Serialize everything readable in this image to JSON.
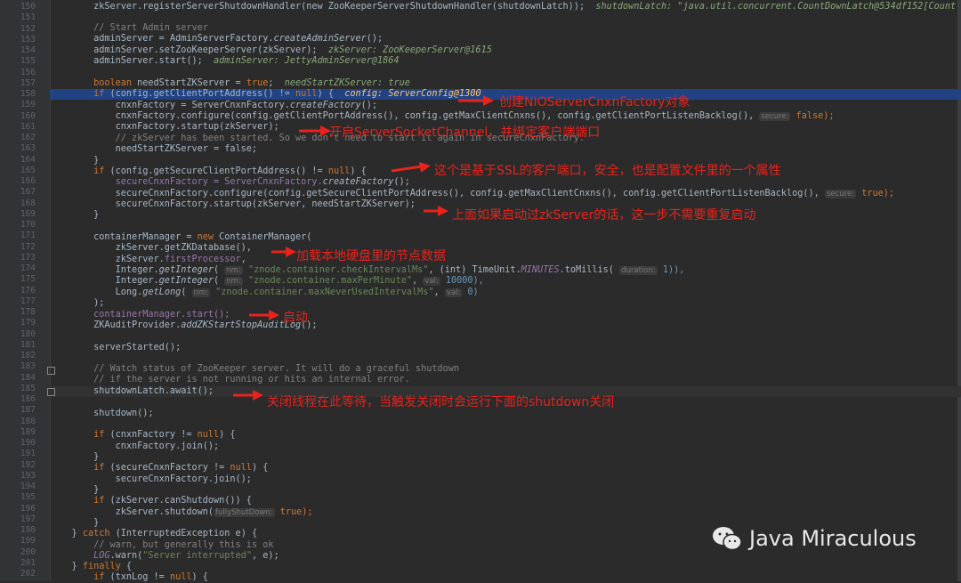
{
  "gutter": {
    "line_numbers": [
      "150",
      "151",
      "152",
      "153",
      "154",
      "155",
      "156",
      "157",
      "158",
      "159",
      "160",
      "161",
      "162",
      "163",
      "164",
      "165",
      "166",
      "167",
      "168",
      "169",
      "170",
      "171",
      "172",
      "173",
      "174",
      "175",
      "176",
      "177",
      "178",
      "179",
      "180",
      "181",
      "182",
      "183",
      "184",
      "185",
      "186",
      "187",
      "188",
      "189",
      "190",
      "191",
      "192",
      "193",
      "194",
      "195",
      "196",
      "197",
      "198",
      "199",
      "200",
      "201",
      "202"
    ]
  },
  "code": {
    "l150": "        zkServer.registerServerShutdownHandler(new ZooKeeperServerShutdownHandler(shutdownLatch));",
    "l150_dbg": "shutdownLatch: \"java.util.concurrent.CountDownLatch@534df152[Count = 1]\"",
    "l152": "        // Start Admin server",
    "l153a": "        adminServer = AdminServerFactory.",
    "l153b": "createAdminServer",
    "l153c": "();",
    "l154": "        adminServer.setZooKeeperServer(zkServer);",
    "l154_dbg": "zkServer: ZooKeeperServer@1615",
    "l155": "        adminServer.start();",
    "l155_dbg": "adminServer: JettyAdminServer@1864",
    "l157a": "        boolean ",
    "l157b": "needStartZKServer = ",
    "l157c": "true",
    "l157d": ";",
    "l157_dbg": "needStartZKServer: true",
    "l158a": "        if ",
    "l158b": "(config.getClientPortAddress() != ",
    "l158c": "null",
    "l158d": ") {",
    "l158_dbg": "config: ServerConfig@1300",
    "l159a": "            cnxnFactory = ServerCnxnFactory.",
    "l159b": "createFactory",
    "l159c": "();",
    "l160": "            cnxnFactory.configure(config.getClientPortAddress(), config.getMaxClientCnxns(), config.getClientPortListenBacklog(),",
    "l160_hint": "secure:",
    "l160_end": " false);",
    "l161": "            cnxnFactory.startup(zkServer);",
    "l162": "            // zkServer has been started. So we don't need to start it again in secureCnxnFactory.",
    "l163": "            needStartZKServer = false;",
    "l164": "        }",
    "l165a": "        if ",
    "l165b": "(config.getSecureClientPortAddress() != ",
    "l165c": "null",
    "l165d": ") {",
    "l166a": "            secureCnxnFactory = ServerCnxnFactory.",
    "l166b": "createFactory",
    "l166c": "();",
    "l167": "            secureCnxnFactory.configure(config.getSecureClientPortAddress(), config.getMaxClientCnxns(), config.getClientPortListenBacklog(),",
    "l167_hint": "secure:",
    "l167_end": " true);",
    "l168": "            secureCnxnFactory.startup(zkServer, needStartZKServer);",
    "l169": "        }",
    "l171a": "        containerManager = ",
    "l171b": "new ",
    "l171c": "ContainerManager(",
    "l172": "            zkServer.getZKDatabase(),",
    "l173a": "            zkServer.",
    "l173b": "firstProcessor",
    "l173c": ",",
    "l174a": "            Integer.",
    "l174b": "getInteger",
    "l174c": "(",
    "l174_hint": "nm:",
    "l174d": " \"znode.container.checkIntervalMs\"",
    "l174e": ", (int) TimeUnit.",
    "l174f": "MINUTES",
    "l174g": ".toMillis(",
    "l174_hint2": "duration:",
    "l174h": " 1)),",
    "l175a": "            Integer.",
    "l175b": "getInteger",
    "l175c": "(",
    "l175_hint": "nm:",
    "l175d": " \"znode.container.maxPerMinute\"",
    "l175e": ", ",
    "l175_hint2": "val:",
    "l175f": " 10000),",
    "l176a": "            Long.",
    "l176b": "getLong",
    "l176c": "(",
    "l176_hint": "nm:",
    "l176d": " \"znode.container.maxNeverUsedIntervalMs\"",
    "l176e": ", ",
    "l176_hint2": "val:",
    "l176f": " 0)",
    "l177": "        );",
    "l178": "        containerManager.start();",
    "l179a": "        ZKAuditProvider.",
    "l179b": "addZKStartStopAuditLog",
    "l179c": "();",
    "l181": "        serverStarted();",
    "l183": "        // Watch status of ZooKeeper server. It will do a graceful shutdown",
    "l184": "        // if the server is not running or hits an internal error.",
    "l185": "        shutdownLatch.await();",
    "l187": "        shutdown();",
    "l189a": "        if ",
    "l189b": "(cnxnFactory != ",
    "l189c": "null",
    "l189d": ") {",
    "l190": "            cnxnFactory.join();",
    "l191": "        }",
    "l192a": "        if ",
    "l192b": "(secureCnxnFactory != ",
    "l192c": "null",
    "l192d": ") {",
    "l193": "            secureCnxnFactory.join();",
    "l194": "        }",
    "l195a": "        if ",
    "l195b": "(zkServer.canShutdown()) {",
    "l196a": "            zkServer.shutdown(",
    "l196_hint": "fullyShutDown:",
    "l196b": " true);",
    "l197": "        }",
    "l198a": "    } ",
    "l198b": "catch ",
    "l198c": "(InterruptedException e) {",
    "l199": "        // warn, but generally this is ok",
    "l200a": "        ",
    "l200b": "LOG",
    "l200c": ".warn(",
    "l200d": "\"Server interrupted\"",
    "l200e": ", e);",
    "l201a": "    } ",
    "l201b": "finally ",
    "l201c": "{",
    "l202a": "        if ",
    "l202b": "(txnLog != ",
    "l202c": "null",
    "l202d": ") {"
  },
  "annotations": {
    "a1": "创建NIOServerCnxnFactory对象",
    "a2": "开启ServerSocketChannel，并绑定客户端端口",
    "a3": "这个是基于SSL的客户端口，安全，也是配置文件里的一个属性",
    "a4": "上面如果启动过zkServer的话，这一步不需要重复启动",
    "a5": "加载本地硬盘里的节点数据",
    "a6": "启动",
    "a7": "关闭线程在此等待，当触发关闭时会运行下面的shutdown关闭"
  },
  "watermark": {
    "text": "Java Miraculous"
  },
  "colors": {
    "background": "#2b2b2b",
    "highlight_line": "#214283",
    "annotation_red": "#e8231c"
  }
}
